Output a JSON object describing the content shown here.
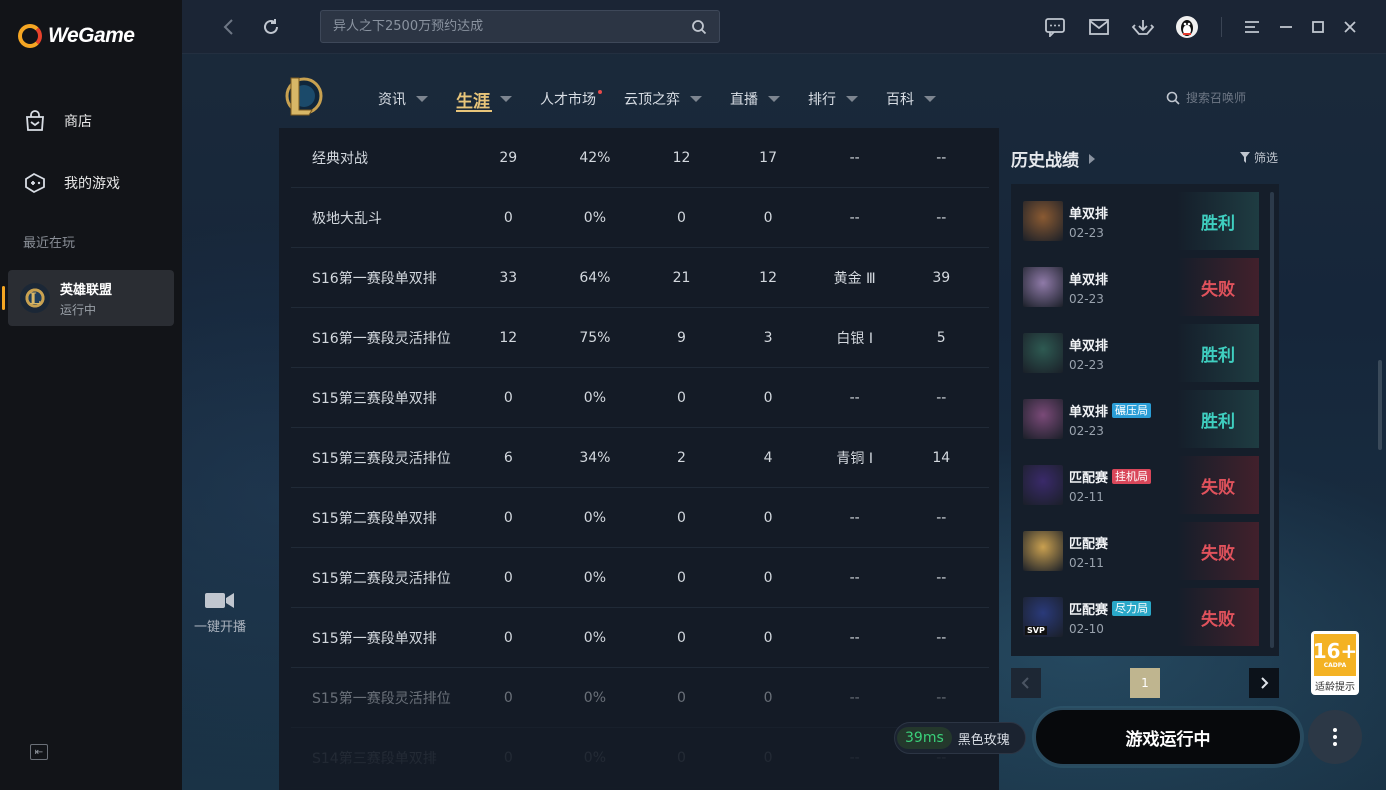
{
  "app": {
    "name": "WeGame"
  },
  "sidebar": {
    "items": [
      {
        "label": "商店",
        "icon": "store-bag-icon"
      },
      {
        "label": "我的游戏",
        "icon": "gamepad-icon"
      }
    ],
    "recent_label": "最近在玩",
    "recent_game": {
      "name": "英雄联盟",
      "status": "运行中",
      "logo_letter": "L"
    }
  },
  "topbar": {
    "search_placeholder": "异人之下2500万预约达成"
  },
  "game_nav": {
    "logo_letter": "L",
    "tabs": [
      {
        "label": "资讯",
        "caret": true
      },
      {
        "label": "生涯",
        "caret": true,
        "active": true
      },
      {
        "label": "人才市场",
        "caret": false,
        "dot": true
      },
      {
        "label": "云顶之弈",
        "caret": true
      },
      {
        "label": "直播",
        "caret": true
      },
      {
        "label": "排行",
        "caret": true
      },
      {
        "label": "百科",
        "caret": true
      }
    ],
    "summoner_search_placeholder": "搜索召唤师"
  },
  "stats": {
    "rows": [
      [
        "经典对战",
        "29",
        "42%",
        "12",
        "17",
        "--",
        "--"
      ],
      [
        "极地大乱斗",
        "0",
        "0%",
        "0",
        "0",
        "--",
        "--"
      ],
      [
        "S16第一赛段单双排",
        "33",
        "64%",
        "21",
        "12",
        "黄金 Ⅲ",
        "39"
      ],
      [
        "S16第一赛段灵活排位",
        "12",
        "75%",
        "9",
        "3",
        "白银 Ⅰ",
        "5"
      ],
      [
        "S15第三赛段单双排",
        "0",
        "0%",
        "0",
        "0",
        "--",
        "--"
      ],
      [
        "S15第三赛段灵活排位",
        "6",
        "34%",
        "2",
        "4",
        "青铜 Ⅰ",
        "14"
      ],
      [
        "S15第二赛段单双排",
        "0",
        "0%",
        "0",
        "0",
        "--",
        "--"
      ],
      [
        "S15第二赛段灵活排位",
        "0",
        "0%",
        "0",
        "0",
        "--",
        "--"
      ],
      [
        "S15第一赛段单双排",
        "0",
        "0%",
        "0",
        "0",
        "--",
        "--"
      ],
      [
        "S15第一赛段灵活排位",
        "0",
        "0%",
        "0",
        "0",
        "--",
        "--"
      ],
      [
        "S14第三赛段单双排",
        "0",
        "0%",
        "0",
        "0",
        "--",
        "--"
      ]
    ]
  },
  "history": {
    "title": "历史战绩",
    "filter_label": "筛选",
    "matches": [
      {
        "mode": "单双排",
        "date": "02-23",
        "result": "胜利",
        "win": true,
        "tag": "",
        "avatar_color": "#8a5a32"
      },
      {
        "mode": "单双排",
        "date": "02-23",
        "result": "失败",
        "win": false,
        "tag": "",
        "avatar_color": "#8f7aa8"
      },
      {
        "mode": "单双排",
        "date": "02-23",
        "result": "胜利",
        "win": true,
        "tag": "",
        "avatar_color": "#2e5a52"
      },
      {
        "mode": "单双排",
        "date": "02-23",
        "result": "胜利",
        "win": true,
        "tag": "碾压局",
        "tag_color": "#2a9dd6",
        "avatar_color": "#7a4a78"
      },
      {
        "mode": "匹配赛",
        "date": "02-11",
        "result": "失败",
        "win": false,
        "tag": "挂机局",
        "tag_color": "#d9475a",
        "avatar_color": "#3a2a6a"
      },
      {
        "mode": "匹配赛",
        "date": "02-11",
        "result": "失败",
        "win": false,
        "tag": "",
        "avatar_color": "#c9a050"
      },
      {
        "mode": "匹配赛",
        "date": "02-10",
        "result": "失败",
        "win": false,
        "tag": "尽力局",
        "tag_color": "#2aa8c8",
        "avatar_color": "#2a3a7a",
        "badge": "SVP"
      }
    ],
    "page": "1"
  },
  "bottom": {
    "one_key_label": "一键开播",
    "ping": "39ms",
    "server": "黑色玫瑰",
    "launch_label": "游戏运行中",
    "age_rating": "16+",
    "age_cadpa": "CADPA",
    "age_tip": "适龄提示"
  }
}
